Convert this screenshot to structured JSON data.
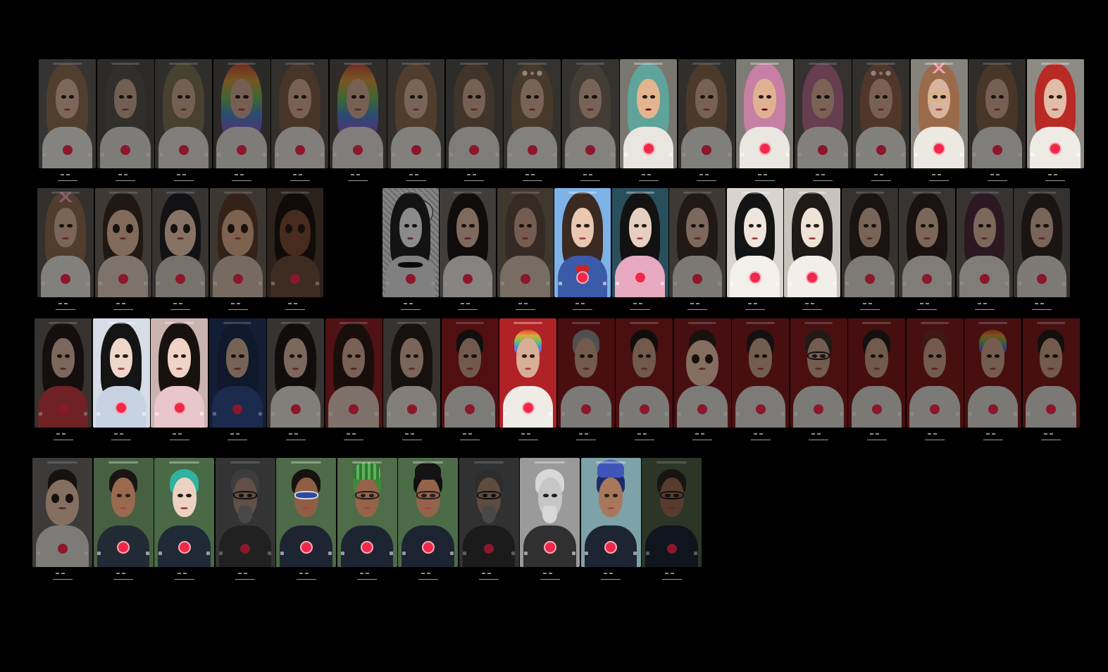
{
  "board": {
    "background": "#000000",
    "accent_record_color": "#f0284a"
  },
  "rows": [
    {
      "name": "row-1",
      "cards": [
        {
          "theme": "portrait-warm",
          "hair": "#8a6b52",
          "skin": "#d7b19b",
          "body": "#e6e2dc",
          "bg": "#5e5b57",
          "dim": true
        },
        {
          "theme": "portrait-warm",
          "hair": "#55514c",
          "skin": "#c5a48f",
          "body": "#d9d6d1",
          "bg": "#4d4b48",
          "dim": true
        },
        {
          "theme": "portrait-warm",
          "hair": "#7b7052",
          "skin": "#c9a690",
          "body": "#dcd8d2",
          "bg": "#545049",
          "dim": true
        },
        {
          "theme": "rainbow-hair",
          "hair": "#5a7fd0",
          "skin": "#caa48e",
          "body": "#dad6d0",
          "bg": "#4a4846",
          "dim": true
        },
        {
          "theme": "portrait-warm",
          "hair": "#7a5c47",
          "skin": "#cfa892",
          "body": "#dedad4",
          "bg": "#56524e",
          "dim": true
        },
        {
          "theme": "rainbow-hair",
          "hair": "#d2602f",
          "skin": "#cea892",
          "body": "#dcd8d2",
          "bg": "#504b48",
          "dim": true
        },
        {
          "theme": "portrait-warm",
          "hair": "#8a6a4e",
          "skin": "#d2ac96",
          "body": "#e1ddd7",
          "bg": "#58534f",
          "dim": true
        },
        {
          "theme": "portrait-warm",
          "hair": "#6f5a4a",
          "skin": "#caa58f",
          "body": "#dbd7d1",
          "bg": "#4f4c49",
          "dim": true
        },
        {
          "theme": "flower-crown",
          "hair": "#7a624d",
          "skin": "#d0aa94",
          "body": "#e2ded8",
          "bg": "#5a5650",
          "dim": true
        },
        {
          "theme": "portrait-warm",
          "hair": "#75695c",
          "skin": "#cfab96",
          "body": "#e4e0da",
          "bg": "#5c5853",
          "dim": true
        },
        {
          "theme": "drag-makeup",
          "hair": "#5fa39a",
          "skin": "#e3b58e",
          "body": "#e9e5df",
          "bg": "#7a7670",
          "dim": false
        },
        {
          "theme": "portrait-warm",
          "hair": "#82644c",
          "skin": "#cda791",
          "body": "#dfdbd5",
          "bg": "#55514c",
          "dim": true
        },
        {
          "theme": "drag-makeup",
          "hair": "#c77fa3",
          "skin": "#e0b293",
          "body": "#eae6e0",
          "bg": "#7e7a74",
          "dim": false
        },
        {
          "theme": "portrait-warm",
          "hair": "#b06c8a",
          "skin": "#d2ab95",
          "body": "#e0dcd6",
          "bg": "#5a5551",
          "dim": true
        },
        {
          "theme": "flower-crown",
          "hair": "#8a5e4a",
          "skin": "#cfa892",
          "body": "#e1ddd7",
          "bg": "#57534e",
          "dim": true
        },
        {
          "theme": "cat-ears-glasses",
          "hair": "#9b6a4b",
          "skin": "#d8b39d",
          "body": "#ece8e2",
          "bg": "#86827c",
          "dim": false
        },
        {
          "theme": "portrait-warm",
          "hair": "#7d5e48",
          "skin": "#cda68f",
          "body": "#ddd9d3",
          "bg": "#514d49",
          "dim": true
        },
        {
          "theme": "red-hair",
          "hair": "#b92a25",
          "skin": "#e1bca6",
          "body": "#eeeae4",
          "bg": "#8e8a84",
          "dim": false
        }
      ]
    },
    {
      "name": "row-2",
      "cards": [
        {
          "theme": "cat-ears",
          "hair": "#8b6a50",
          "skin": "#d4ae98",
          "body": "#e1ddd7",
          "bg": "#58544f",
          "dim": true
        },
        {
          "theme": "cartoon",
          "hair": "#3a2a22",
          "skin": "#e1b89c",
          "body": "#d8c7b8",
          "bg": "#6c625a",
          "dim": true
        },
        {
          "theme": "cartoon",
          "hair": "#1f1f24",
          "skin": "#e9c7b0",
          "body": "#cfc4ba",
          "bg": "#5f5a56",
          "dim": true
        },
        {
          "theme": "cartoon",
          "hair": "#5b3b2c",
          "skin": "#d9a98a",
          "body": "#cdb8a8",
          "bg": "#6a5f57",
          "dim": true
        },
        {
          "theme": "cartoon",
          "hair": "#1b1411",
          "skin": "#7a4c34",
          "body": "#6b4c3b",
          "bg": "#4b3b31",
          "dim": true
        },
        {
          "theme": "comic",
          "hair": "#222222",
          "skin": "#f0f0f0",
          "body": "#dcdcdc",
          "bg": "#9a9a9a",
          "dim": true
        },
        {
          "theme": "red-ribbon",
          "hair": "#1c1715",
          "skin": "#d9b5a0",
          "body": "#e7e2dc",
          "bg": "#6e6a65",
          "dim": true
        },
        {
          "theme": "vintage",
          "hair": "#5c4a3e",
          "skin": "#c8a08a",
          "body": "#cdbcab",
          "bg": "#6f5f50",
          "dim": true
        },
        {
          "theme": "sailor",
          "hair": "#3a2a22",
          "skin": "#e9c7b0",
          "body": "#3b5aa8",
          "bg": "#7fb2e6",
          "dim": false
        },
        {
          "theme": "gothic",
          "hair": "#121212",
          "skin": "#e6cfc0",
          "body": "#e6a9c0",
          "bg": "#2a4f5c",
          "dim": false
        },
        {
          "theme": "portrait-asian",
          "hair": "#3a2b25",
          "skin": "#d7b4a0",
          "body": "#d6cfc6",
          "bg": "#6b625a",
          "dim": true
        },
        {
          "theme": "ink-face",
          "hair": "#141414",
          "skin": "#f0e5dc",
          "body": "#f3efea",
          "bg": "#d8d3cd",
          "dim": false
        },
        {
          "theme": "opera",
          "hair": "#1f1a18",
          "skin": "#efe2d6",
          "body": "#f2efea",
          "bg": "#c9c3bc",
          "dim": false
        },
        {
          "theme": "portrait-asian",
          "hair": "#2b2220",
          "skin": "#d1ad98",
          "body": "#d9d3cb",
          "bg": "#5c5753",
          "dim": true
        },
        {
          "theme": "portrait-asian",
          "hair": "#2b1f1c",
          "skin": "#d3b09b",
          "body": "#dcd6ce",
          "bg": "#615c57",
          "dim": true
        },
        {
          "theme": "portrait-asian",
          "hair": "#4a2a3a",
          "skin": "#d6b19d",
          "body": "#ddd7cf",
          "bg": "#615b57",
          "dim": true
        },
        {
          "theme": "portrait-asian",
          "hair": "#2e2421",
          "skin": "#d0ad99",
          "body": "#d8d2ca",
          "bg": "#5a5551",
          "dim": true
        }
      ]
    },
    {
      "name": "row-3",
      "cards": [
        {
          "theme": "portrait-asian",
          "hair": "#241b19",
          "skin": "#d6b2a0",
          "body": "#c23a3e",
          "bg": "#5c5652",
          "dim": true
        },
        {
          "theme": "hanfu",
          "hair": "#141414",
          "skin": "#eed7ca",
          "body": "#c7d3e3",
          "bg": "#d7dde6",
          "dim": false
        },
        {
          "theme": "hanfu",
          "hair": "#17120f",
          "skin": "#efd3c6",
          "body": "#e9c6cc",
          "bg": "#cbb3b0",
          "dim": false
        },
        {
          "theme": "portrait-asian",
          "hair": "#1d2a4a",
          "skin": "#cda995",
          "body": "#2e4a86",
          "bg": "#22345e",
          "dim": true
        },
        {
          "theme": "red-ribbon",
          "hair": "#1c1715",
          "skin": "#d5b19d",
          "body": "#e1dbd3",
          "bg": "#5e5954",
          "dim": true
        },
        {
          "theme": "red-bg",
          "hair": "#2a1a16",
          "skin": "#d0a894",
          "body": "#d8c3b6",
          "bg": "#8a1f23",
          "dim": true
        },
        {
          "theme": "portrait-asian",
          "hair": "#271e1b",
          "skin": "#d3af9b",
          "body": "#e0dbd3",
          "bg": "#5e5954",
          "dim": true
        },
        {
          "theme": "male",
          "hair": "#1d1a19",
          "skin": "#c39a85",
          "body": "#d8d4cf",
          "bg": "#8c1a1e",
          "dim": true
        },
        {
          "theme": "male-rainbow",
          "hair": "#7f56d6",
          "skin": "#d8ae96",
          "body": "#efece8",
          "bg": "#b02226",
          "dim": false
        },
        {
          "theme": "male",
          "hair": "#8a8a8a",
          "skin": "#c49c87",
          "body": "#d6d2cd",
          "bg": "#7f1a1d",
          "dim": true
        },
        {
          "theme": "male",
          "hair": "#1c1918",
          "skin": "#c39984",
          "body": "#d4d0cb",
          "bg": "#801a1d",
          "dim": true
        },
        {
          "theme": "cartoon-male",
          "hair": "#2a1f1b",
          "skin": "#e3bea6",
          "body": "#d8d4cf",
          "bg": "#7a1b1f",
          "dim": true
        },
        {
          "theme": "male",
          "hair": "#241e1c",
          "skin": "#c6a08b",
          "body": "#d7d3ce",
          "bg": "#7d1a1e",
          "dim": true
        },
        {
          "theme": "male-glasses",
          "hair": "#3a2e29",
          "skin": "#c7a18c",
          "body": "#d6d2cd",
          "bg": "#7e1b1e",
          "dim": true
        },
        {
          "theme": "male",
          "hair": "#221c1a",
          "skin": "#c39b86",
          "body": "#d4d0cb",
          "bg": "#7a191c",
          "dim": true
        },
        {
          "theme": "male",
          "hair": "#6a2a24",
          "skin": "#c79e88",
          "body": "#d6d2cd",
          "bg": "#7d1a1d",
          "dim": true
        },
        {
          "theme": "male-rainbow",
          "hair": "#5f7fd6",
          "skin": "#c89f8a",
          "body": "#d5d1cc",
          "bg": "#7a1a1c",
          "dim": true
        },
        {
          "theme": "male",
          "hair": "#1f1a18",
          "skin": "#c49b86",
          "body": "#d5d1cc",
          "bg": "#7c1a1d",
          "dim": true
        }
      ]
    },
    {
      "name": "row-4",
      "cards": [
        {
          "theme": "cartoon-male",
          "hair": "#2a1f1b",
          "skin": "#e3c0a8",
          "body": "#d8d4cf",
          "bg": "#6a6662",
          "dim": true
        },
        {
          "theme": "man-smoke",
          "hair": "#1a1412",
          "skin": "#9a6a4f",
          "body": "#222a36",
          "bg": "#486042",
          "dim": false
        },
        {
          "theme": "anime-teal",
          "hair": "#2fb3a0",
          "skin": "#ecd2c2",
          "body": "#1f2a36",
          "bg": "#4a6a46",
          "dim": false
        },
        {
          "theme": "bald-beard",
          "hair": "#6a6a6a",
          "skin": "#a98a79",
          "body": "#3a3a3a",
          "bg": "#5a5a5a",
          "dim": true
        },
        {
          "theme": "dreads-glasses",
          "hair": "#151210",
          "skin": "#8f5f45",
          "body": "#1d2533",
          "bg": "#4e6a48",
          "dim": false
        },
        {
          "theme": "melon-hat",
          "hair": "#3a8a3a",
          "skin": "#946449",
          "body": "#1d2533",
          "bg": "#4f6c48",
          "dim": false
        },
        {
          "theme": "cap-glasses",
          "hair": "#101010",
          "skin": "#93634a",
          "body": "#1c2432",
          "bg": "#4c6b47",
          "dim": false
        },
        {
          "theme": "bald-beard",
          "hair": "#4e4e4e",
          "skin": "#a3846f",
          "body": "#2f2f2f",
          "bg": "#555555",
          "dim": true
        },
        {
          "theme": "statue",
          "hair": "#d8d8d8",
          "skin": "#c6c6c6",
          "body": "#303030",
          "bg": "#9a9a9a",
          "dim": false
        },
        {
          "theme": "official-hat",
          "hair": "#1d2a6a",
          "skin": "#a9785c",
          "body": "#1d2533",
          "bg": "#7da2a8",
          "dim": false
        },
        {
          "theme": "man-plain",
          "hair": "#2a2320",
          "skin": "#946650",
          "body": "#1c2432",
          "bg": "#4a5e42",
          "dim": true
        }
      ]
    }
  ]
}
